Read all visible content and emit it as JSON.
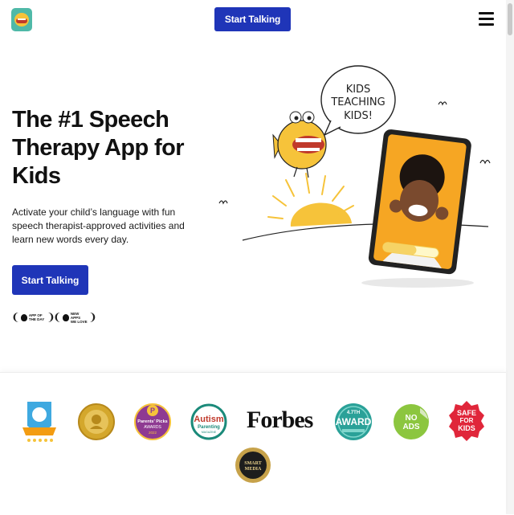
{
  "header": {
    "logo_icon": "speech-blubs-fish-logo",
    "cta_label": "Start Talking",
    "menu_icon": "hamburger-menu-icon"
  },
  "hero": {
    "title": "The #1 Speech Therapy App for Kids",
    "subtitle": "Activate your child’s language with fun speech therapist-approved activities and learn new words every day.",
    "cta_label": "Start Talking",
    "laurels": [
      {
        "line1": "APP OF",
        "line2": "THE DAY"
      },
      {
        "line1": "NEW APPS",
        "line2": "WE LOVE"
      }
    ],
    "bubble_lines": [
      "KIDS",
      "TEACHING",
      "KIDS!"
    ]
  },
  "awards": {
    "forbes_label": "Forbes",
    "autism_line1": "Autism",
    "autism_line2": "Parenting",
    "autism_line3": "MAGAZINE",
    "award_label": "AWARD",
    "award_top": "4.7TH",
    "no_ads_line1": "NO",
    "no_ads_line2": "ADS",
    "safe_line1": "SAFE",
    "safe_line2": "FOR",
    "safe_line3": "KIDS",
    "parents_line1": "Parents' Picks",
    "parents_line2": "AWARDS",
    "parents_year": "2022",
    "smart_line1": "SMART",
    "smart_line2": "MEDIA"
  },
  "colors": {
    "primary_blue": "#1f35b8",
    "sun_yellow": "#f6c33a",
    "tablet_orange": "#f6a623"
  }
}
